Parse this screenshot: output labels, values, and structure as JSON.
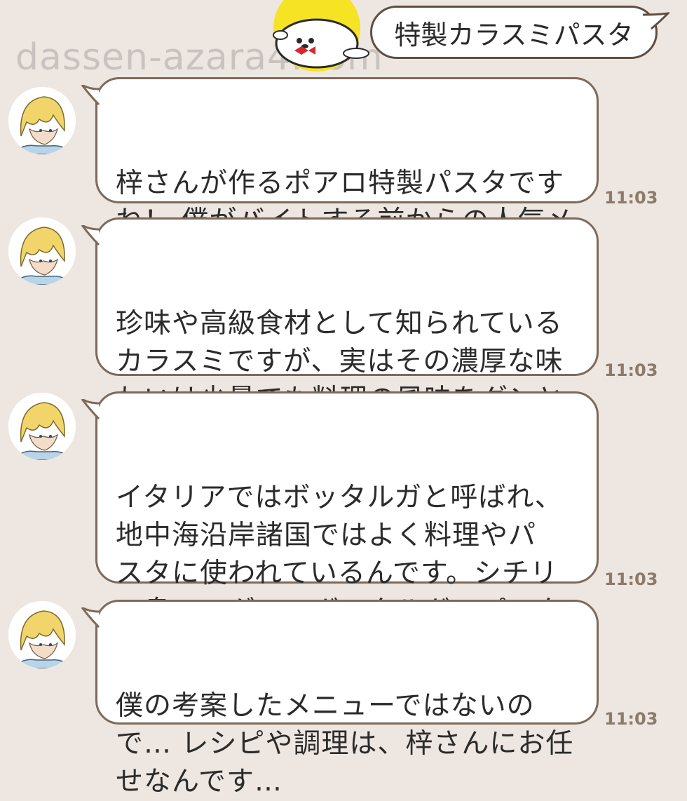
{
  "watermark": "dassen-azara4.com",
  "header_bubble": {
    "text": "特製カラスミパスタ"
  },
  "messages": [
    {
      "text": "梓さんが作るポアロ特製パスタです\nね！ 僕がバイトする前からの人気メ\nニューですよ",
      "time": "11:03"
    },
    {
      "text": "珍味や高級食材として知られている\nカラスミですが、実はその濃厚な味\nわいは少量でも料理の風味をグンと\nアップしてくれるんです",
      "time": "11:03"
    },
    {
      "text": "イタリアではボッタルガと呼ばれ、\n地中海沿岸諸国ではよく料理やパ\nスタに使われているんです。シチリ\nア島のマグロのボッタルガのパスタ\nは、まさに絶品だそうですよ",
      "time": "11:03"
    },
    {
      "text": "僕の考案したメニューではないの\nで… レシピや調理は、梓さんにお任\nせなんです…",
      "time": "11:03"
    }
  ],
  "colors": {
    "background": "#ede6e1",
    "bubble_border": "#7d6a5b",
    "time_text": "#8c7a6a",
    "mascot_circle": "#f6e324"
  },
  "icons": [
    "seal-mascot-icon",
    "avatar-icon"
  ]
}
